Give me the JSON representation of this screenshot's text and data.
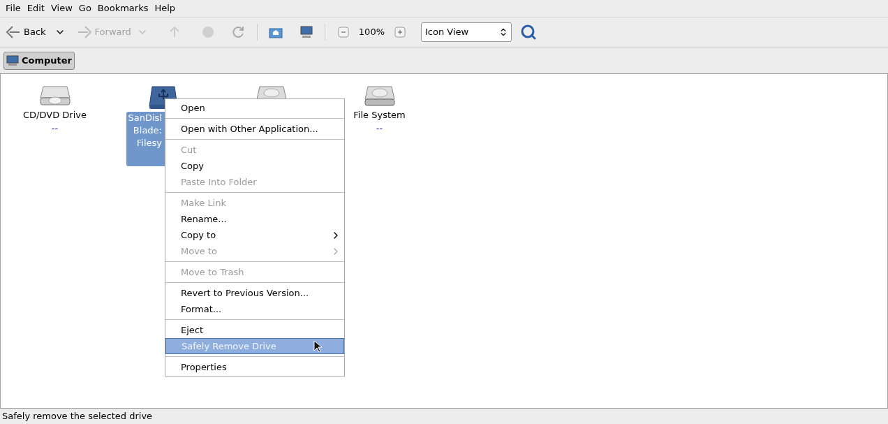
{
  "menubar": [
    "File",
    "Edit",
    "View",
    "Go",
    "Bookmarks",
    "Help"
  ],
  "toolbar": {
    "back": {
      "label": "Back",
      "disabled": false
    },
    "forward": {
      "label": "Forward",
      "disabled": true
    },
    "zoom": "100%",
    "view_select": "Icon View"
  },
  "location": {
    "label": "Computer",
    "selected": true
  },
  "icons": [
    {
      "kind": "optical",
      "lines": [
        "CD/DVD Drive"
      ],
      "sub": "--",
      "selected": false
    },
    {
      "kind": "usb",
      "lines": [
        "SanDisl",
        "Blade:",
        "Filesy"
      ],
      "selected": true
    },
    {
      "kind": "disk",
      "selected": false
    },
    {
      "kind": "disk",
      "lines": [
        "File System"
      ],
      "sub": "--",
      "selected": false
    }
  ],
  "context_menu": [
    [
      {
        "label": "Open",
        "disabled": false,
        "selected": false,
        "submenu": false
      }
    ],
    [
      {
        "label": "Open with Other Application...",
        "disabled": false,
        "selected": false,
        "submenu": false
      }
    ],
    [
      {
        "label": "Cut",
        "disabled": true,
        "selected": false,
        "submenu": false
      },
      {
        "label": "Copy",
        "disabled": false,
        "selected": false,
        "submenu": false
      },
      {
        "label": "Paste Into Folder",
        "disabled": true,
        "selected": false,
        "submenu": false
      }
    ],
    [
      {
        "label": "Make Link",
        "disabled": true,
        "selected": false,
        "submenu": false
      },
      {
        "label": "Rename...",
        "disabled": false,
        "selected": false,
        "submenu": false
      },
      {
        "label": "Copy to",
        "disabled": false,
        "selected": false,
        "submenu": true
      },
      {
        "label": "Move to",
        "disabled": true,
        "selected": false,
        "submenu": true
      }
    ],
    [
      {
        "label": "Move to Trash",
        "disabled": true,
        "selected": false,
        "submenu": false
      }
    ],
    [
      {
        "label": "Revert to Previous Version...",
        "disabled": false,
        "selected": false,
        "submenu": false
      },
      {
        "label": "Format...",
        "disabled": false,
        "selected": false,
        "submenu": false
      }
    ],
    [
      {
        "label": "Eject",
        "disabled": false,
        "selected": false,
        "submenu": false
      },
      {
        "label": "Safely Remove Drive",
        "disabled": false,
        "selected": true,
        "submenu": false
      }
    ],
    [
      {
        "label": "Properties",
        "disabled": false,
        "selected": false,
        "submenu": false
      }
    ]
  ],
  "status_bar": "Safely remove the selected drive"
}
